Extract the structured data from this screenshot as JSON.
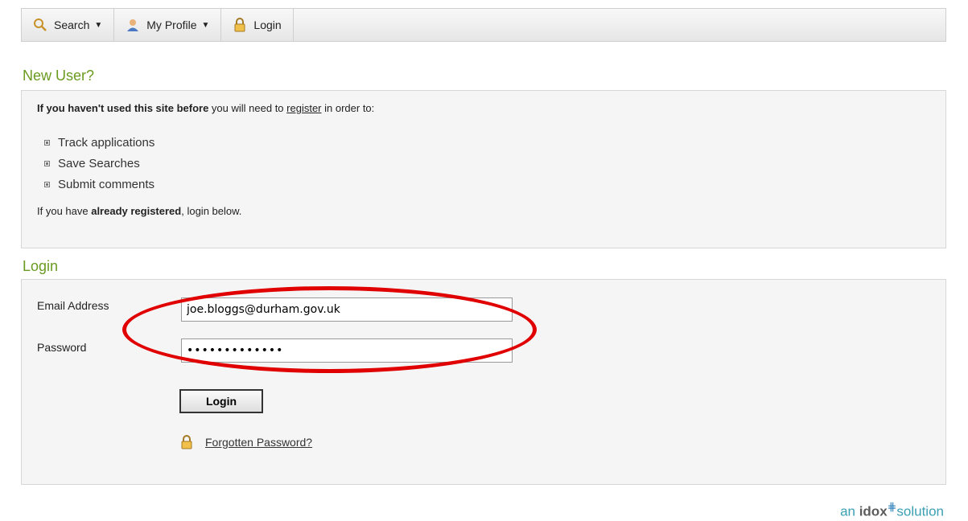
{
  "toolbar": {
    "search_label": "Search",
    "profile_label": "My Profile",
    "login_label": "Login"
  },
  "new_user": {
    "heading": "New User?",
    "intro_bold": "If you haven't used this site before",
    "intro_mid": " you will need to ",
    "register_link": "register",
    "intro_end": " in order to:",
    "items": [
      "Track applications",
      "Save Searches",
      "Submit comments"
    ],
    "outro_start": "If you have ",
    "outro_bold": "already registered",
    "outro_end": ", login below."
  },
  "login": {
    "heading": "Login",
    "email_label": "Email Address",
    "email_value": "joe.bloggs@durham.gov.uk",
    "password_label": "Password",
    "password_value": "•••••••••••••",
    "button_label": "Login",
    "forgot_link": "Forgotten Password?"
  },
  "footer": {
    "an": "an ",
    "brand": "idox",
    "mark": "⋕",
    "solution": "solution"
  },
  "colors": {
    "heading_green": "#6a9a1f",
    "annotation_red": "#e00000"
  }
}
